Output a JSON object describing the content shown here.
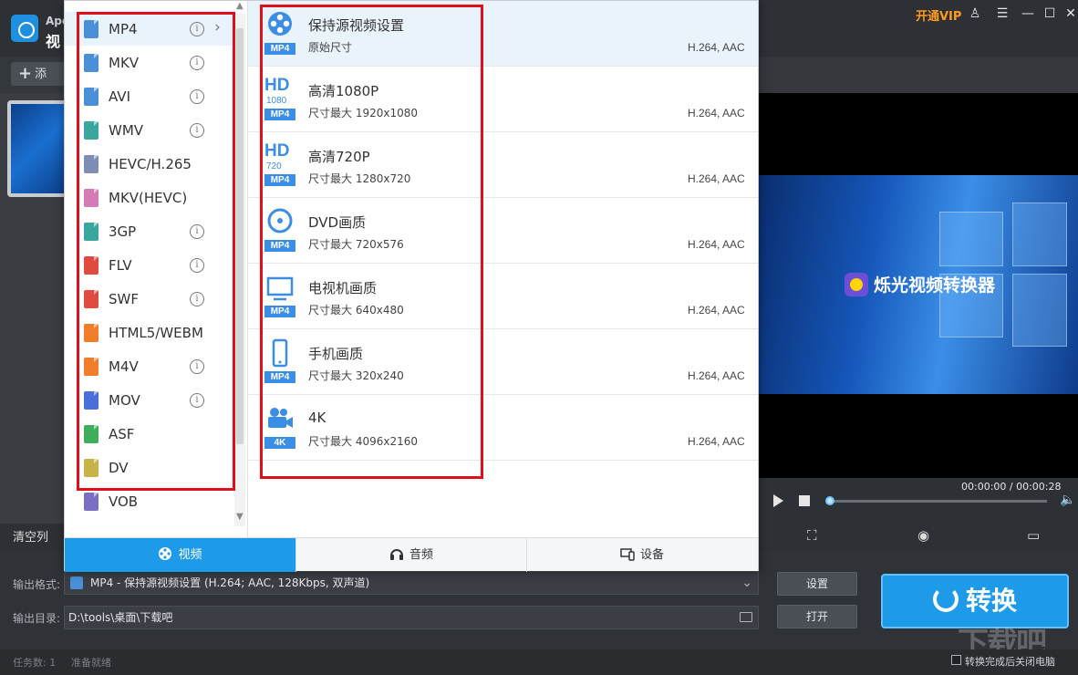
{
  "app": {
    "name_top": "Ape",
    "name_bottom": "视",
    "vip_label": "开通VIP",
    "window_buttons": [
      "♙",
      "☰",
      "—",
      "☐",
      "✕"
    ],
    "add_button_label": "添"
  },
  "format_popup": {
    "formats": [
      {
        "label": "MP4",
        "info": true,
        "selected": true,
        "has_arrow": true,
        "color": "#4a90d9"
      },
      {
        "label": "MKV",
        "info": true,
        "selected": false,
        "color": "#4a90d9"
      },
      {
        "label": "AVI",
        "info": true,
        "selected": false,
        "color": "#4a90d9"
      },
      {
        "label": "WMV",
        "info": true,
        "selected": false,
        "color": "#3aa6a0"
      },
      {
        "label": "HEVC/H.265",
        "info": false,
        "selected": false,
        "color": "#7d8db5"
      },
      {
        "label": "MKV(HEVC)",
        "info": false,
        "selected": false,
        "color": "#d47ab5"
      },
      {
        "label": "3GP",
        "info": true,
        "selected": false,
        "color": "#3aa6a0"
      },
      {
        "label": "FLV",
        "info": true,
        "selected": false,
        "color": "#e04a3f"
      },
      {
        "label": "SWF",
        "info": true,
        "selected": false,
        "color": "#e04a3f"
      },
      {
        "label": "HTML5/WEBM",
        "info": false,
        "selected": false,
        "color": "#ef7d2a"
      },
      {
        "label": "M4V",
        "info": true,
        "selected": false,
        "color": "#ef7d2a"
      },
      {
        "label": "MOV",
        "info": true,
        "selected": false,
        "color": "#4a6fd9"
      },
      {
        "label": "ASF",
        "info": false,
        "selected": false,
        "color": "#3fae5a"
      },
      {
        "label": "DV",
        "info": false,
        "selected": false,
        "color": "#c8b24a"
      },
      {
        "label": "VOB",
        "info": false,
        "selected": false,
        "color": "#7b6fc4"
      }
    ],
    "info_glyph": "i",
    "arrow_glyph": "›",
    "presets": [
      {
        "name": "保持源视频设置",
        "size": "原始尺寸",
        "codec": "H.264, AAC",
        "badge": "MP4",
        "icon": "film-reel-icon",
        "selected": true
      },
      {
        "name": "高清1080P",
        "size": "尺寸最大  1920x1080",
        "codec": "H.264, AAC",
        "badge": "MP4",
        "icon": "hd-1080-icon",
        "hd_text": "HD",
        "hd_sub": "1080"
      },
      {
        "name": "高清720P",
        "size": "尺寸最大  1280x720",
        "codec": "H.264, AAC",
        "badge": "MP4",
        "icon": "hd-720-icon",
        "hd_text": "HD",
        "hd_sub": "720"
      },
      {
        "name": "DVD画质",
        "size": "尺寸最大  720x576",
        "codec": "H.264, AAC",
        "badge": "MP4",
        "icon": "dvd-disc-icon"
      },
      {
        "name": "电视机画质",
        "size": "尺寸最大  640x480",
        "codec": "H.264, AAC",
        "badge": "MP4",
        "icon": "tv-icon"
      },
      {
        "name": "手机画质",
        "size": "尺寸最大  320x240",
        "codec": "H.264, AAC",
        "badge": "MP4",
        "icon": "phone-icon"
      },
      {
        "name": "4K",
        "size": "尺寸最大  4096x2160",
        "codec": "H.264, AAC",
        "badge": "4K",
        "icon": "camera-4k-icon"
      }
    ],
    "tabs": [
      {
        "label": "视频",
        "active": true,
        "icon": "film-reel-icon"
      },
      {
        "label": "音频",
        "active": false,
        "icon": "headphones-icon"
      },
      {
        "label": "设备",
        "active": false,
        "icon": "devices-icon"
      }
    ]
  },
  "preview": {
    "watermark": "烁光视频转换器",
    "time": "00:00:00 / 00:00:28"
  },
  "toolbar": {
    "clear_list": "清空列"
  },
  "output": {
    "format_label": "输出格式:",
    "format_value": "MP4 - 保持源视频设置 (H.264; AAC, 128Kbps, 双声道)",
    "dir_label": "输出目录:",
    "dir_value": "D:\\tools\\桌面\\下载吧",
    "settings_button": "设置",
    "open_button": "打开",
    "convert_button": "转换"
  },
  "status": {
    "task_count": "任务数: 1",
    "ready": "准备就绪",
    "shutdown_label": "转换完成后关闭电脑",
    "site_watermark": "下载吧"
  },
  "colors": {
    "accent": "#1e9be8",
    "highlight_box": "#e0101a",
    "vip": "#ff9a1f"
  }
}
